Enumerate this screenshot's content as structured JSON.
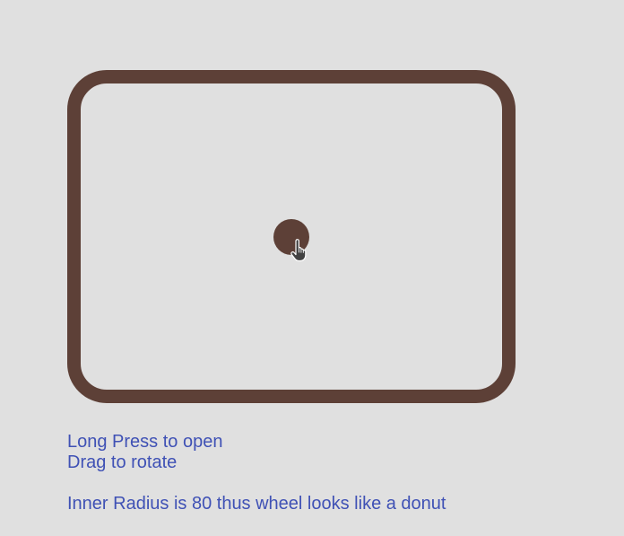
{
  "wheel": {
    "frame_color": "#5d4037",
    "knob_color": "#5d4037",
    "cursor_icon": "hand-pointer-icon"
  },
  "instructions": {
    "line1": "Long Press to open",
    "line2": "Drag to rotate",
    "line3": "Inner Radius is 80 thus wheel looks like a donut",
    "text_color": "#3f51b5"
  },
  "page": {
    "background": "#e0e0e0"
  }
}
